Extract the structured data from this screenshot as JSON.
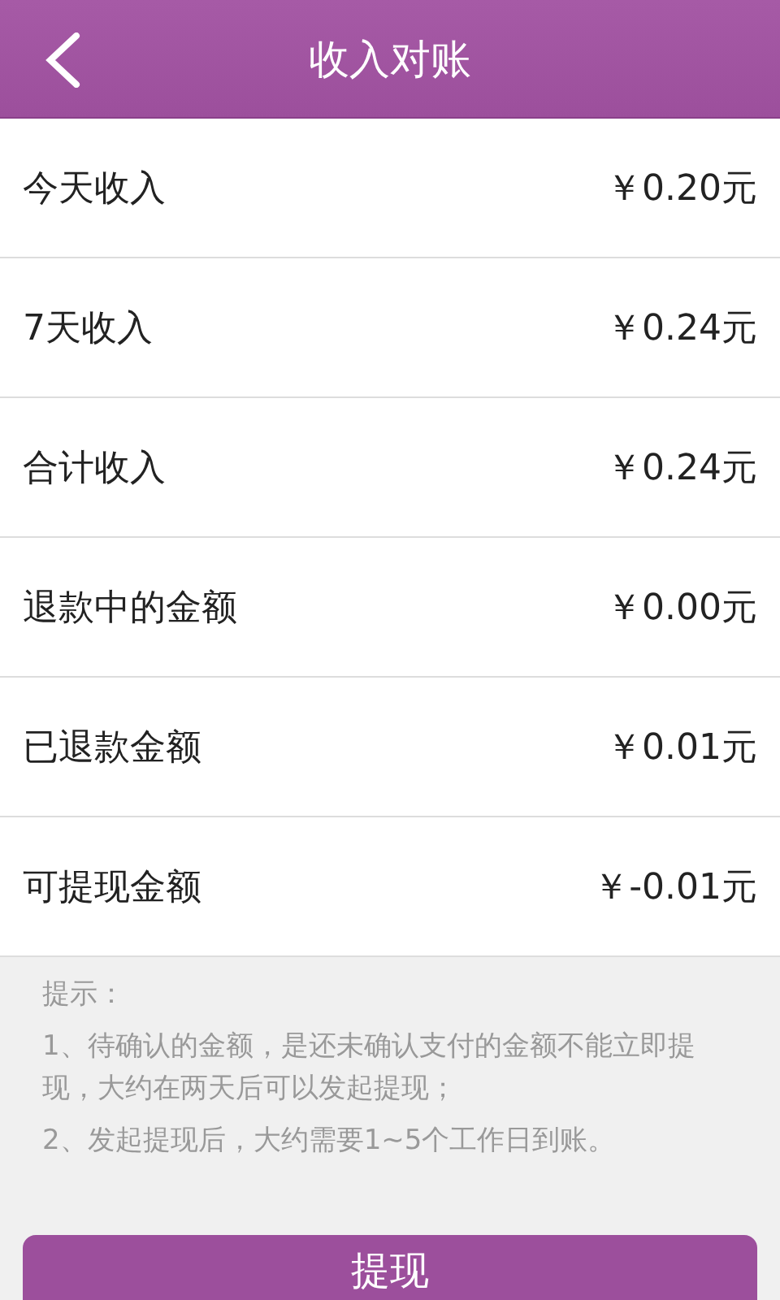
{
  "header": {
    "title": "收入对账"
  },
  "rows": [
    {
      "label": "今天收入",
      "value": "￥0.20元"
    },
    {
      "label": "7天收入",
      "value": "￥0.24元"
    },
    {
      "label": "合计收入",
      "value": "￥0.24元"
    },
    {
      "label": "退款中的金额",
      "value": "￥0.00元"
    },
    {
      "label": "已退款金额",
      "value": "￥0.01元"
    },
    {
      "label": "可提现金额",
      "value": "￥-0.01元"
    }
  ],
  "tips": {
    "title": "提示：",
    "items": [
      "1、待确认的金额，是还未确认支付的金额不能立即提现，大约在两天后可以发起提现；",
      "2、发起提现后，大约需要1~5个工作日到账。"
    ]
  },
  "button": {
    "label": "提现"
  }
}
